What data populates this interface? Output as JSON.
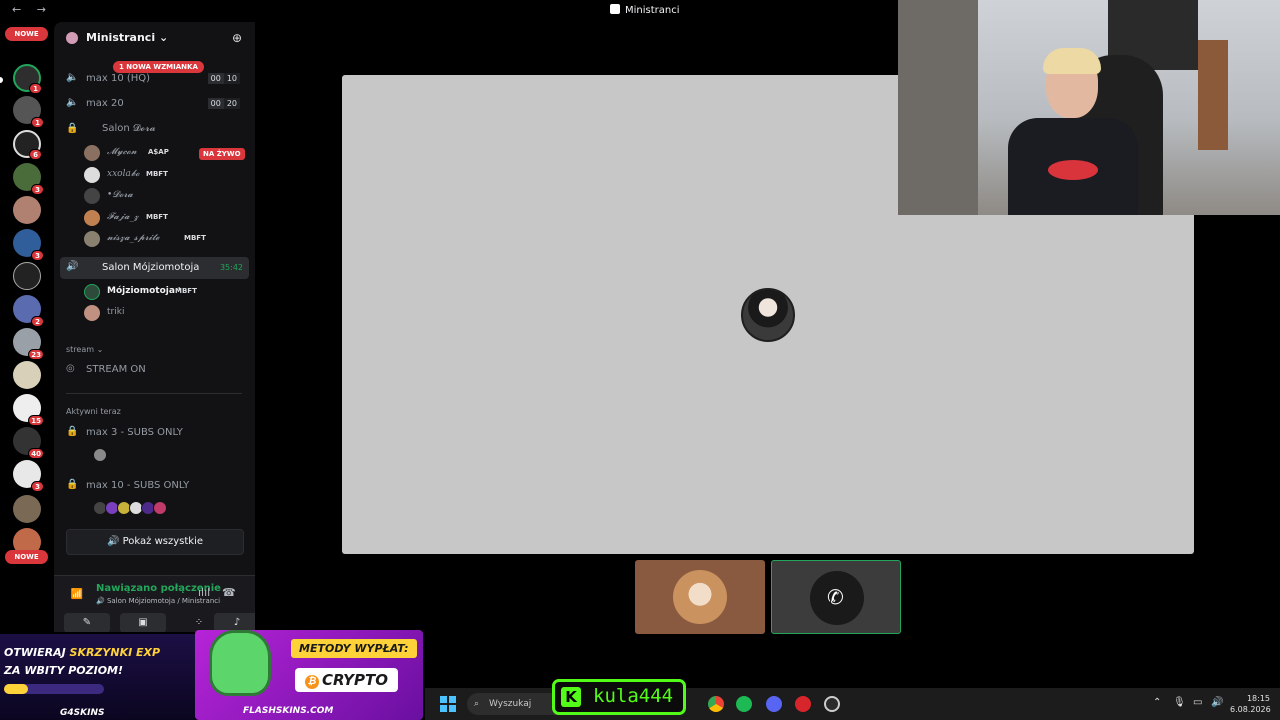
{
  "window": {
    "nav_arrows": "← →",
    "title": "Ministranci"
  },
  "servers": {
    "new_top": "NOWE",
    "new_bottom": "NOWE",
    "badges": [
      "1",
      "1",
      "6",
      "3",
      "3",
      "2",
      "23",
      "15",
      "40",
      "3"
    ]
  },
  "guild": {
    "name": "Ministranci",
    "chevron": "⌄",
    "mention_pill": "1 NOWA WZMIANKA"
  },
  "voice_channels": [
    {
      "name": "max 10 (HQ)",
      "users": "00",
      "limit": "10"
    },
    {
      "name": "max 20",
      "users": "00",
      "limit": "20"
    }
  ],
  "salon_dora": {
    "name": "Salon 𝓓𝓸𝓻𝓪",
    "live_label": "NA ŻYWO",
    "members": [
      {
        "name": "𝓜𝔂𝓬𝓸𝓷",
        "tag": "A$AP"
      },
      {
        "name": "xxola𝓫𝓸",
        "tag": "MBFT"
      },
      {
        "name": "•𝓓𝓸𝓻𝓪",
        "tag": ""
      },
      {
        "name": "𝓕𝓪𝓳𝓪_𝔃",
        "tag": "MBFT"
      },
      {
        "name": "𝓷𝓲𝓼𝔃𝓪_𝓼𝓹𝓻𝓲𝓽𝓮",
        "tag": "MBFT"
      }
    ]
  },
  "salon_active": {
    "name": "Salon Mójziomotoja",
    "timer": "35:42",
    "members": [
      {
        "name": "Mójziomotoja ᵎ",
        "tag": "MBFT"
      },
      {
        "name": "triki",
        "tag": ""
      }
    ]
  },
  "stream_category": {
    "label": "stream ⌄",
    "channel": "STREAM ON"
  },
  "active_now": {
    "label": "Aktywni teraz",
    "channels": [
      "max 3 - SUBS ONLY",
      "max 10 - SUBS ONLY"
    ],
    "show_all": "Pokaż wszystkie"
  },
  "voice_status": {
    "status": "Nawiązano połączenie",
    "location": "Salon Mójziomotoja / Ministranci"
  },
  "ads": {
    "ad1_line1_a": "OTWIERAJ ",
    "ad1_line1_b": "SKRZYNKI EXP",
    "ad1_line2": "ZA WBITY POZIOM!",
    "ad1_brand": "G4SKINS",
    "ad1_progress": 0.24,
    "ad2_line1": "METODY WYPŁAT:",
    "ad2_line2": "CRYPTO",
    "ad2_brand": "FLASHSKINS.COM"
  },
  "taskbar": {
    "search_placeholder": "Wyszukaj",
    "kick_letter": "K",
    "kick_name": "kula444",
    "time": "18:15",
    "date": "6.08.2026"
  },
  "colors": {
    "accent_green": "#23a55a",
    "danger_red": "#da373c",
    "kick_green": "#53fc18"
  }
}
